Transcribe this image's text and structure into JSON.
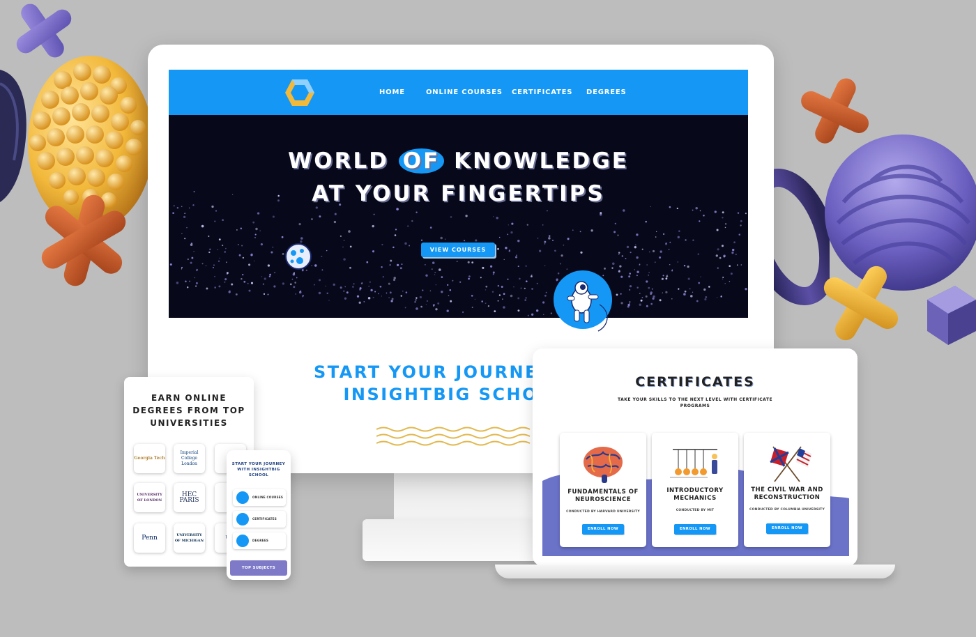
{
  "nav": {
    "links": [
      "Home",
      "Online Courses",
      "Certificates",
      "Degrees"
    ]
  },
  "hero": {
    "line1_a": "WORLD ",
    "line1_of": "OF",
    "line1_b": " KNOWLEDGE",
    "line2": "AT YOUR FINGERTIPS",
    "cta": "VIEW COURSES"
  },
  "journey": {
    "line1": "START YOUR JOURNE",
    "line2": "INSIGHTBIG SCHO"
  },
  "certificates": {
    "title": "CERTIFICATES",
    "subtitle": "TAKE YOUR SKILLS TO THE NEXT LEVEL WITH CERTIFICATE PROGRAMS",
    "cards": [
      {
        "title": "FUNDAMENTALS OF NEUROSCIENCE",
        "by": "CONDUCTED BY HARVARD UNIVERSITY",
        "button": "ENROLL NOW",
        "icon": "brain-icon"
      },
      {
        "title": "INTRODUCTORY MECHANICS",
        "by": "CONDUCTED BY MIT",
        "button": "ENROLL NOW",
        "icon": "newtons-cradle-icon"
      },
      {
        "title": "THE CIVIL WAR AND RECONSTRUCTION",
        "by": "CONDUCTED BY COLUMBIA UNIVERSITY",
        "button": "ENROLL NOW",
        "icon": "crossed-flags-icon"
      }
    ]
  },
  "tablet": {
    "title": "EARN ONLINE DEGREES FROM TOP UNIVERSITIES",
    "universities": [
      {
        "name": "Georgia Tech"
      },
      {
        "name": "Imperial College London"
      },
      {
        "name": "P"
      },
      {
        "name": "UNIVERSITY OF LONDON"
      },
      {
        "name": "HEC PARIS"
      },
      {
        "name": "I"
      },
      {
        "name": "Penn"
      },
      {
        "name": "UNIVERSITY OF MICHIGAN"
      },
      {
        "name": "Univ"
      }
    ]
  },
  "phone": {
    "title": "START YOUR JOURNEY WITH INSIGHTBIG SCHOOL",
    "items": [
      "ONLINE COURSES",
      "CERTIFICATES",
      "DEGREES"
    ],
    "footer": "TOP SUBJECTS"
  },
  "colors": {
    "primary": "#1598f5",
    "hero_bg": "#07091a",
    "accent_purple": "#7e7ac8",
    "accent_orange": "#c95a2a",
    "accent_yellow": "#f2b93b",
    "background": "#bdbdbd"
  }
}
